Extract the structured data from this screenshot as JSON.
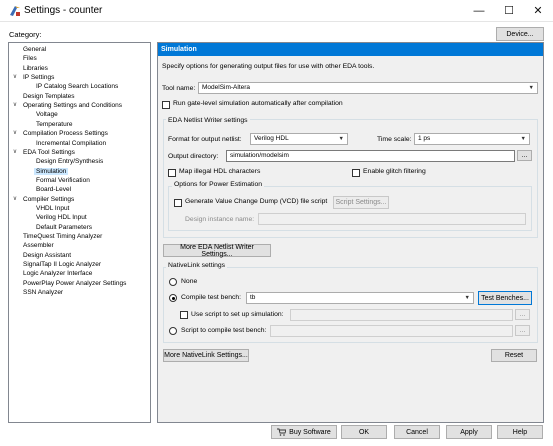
{
  "window": {
    "title": "Settings - counter",
    "minimize": "—",
    "maximize": "☐",
    "close": "✕"
  },
  "header": {
    "category_label": "Category:",
    "device_button": "Device..."
  },
  "tree": [
    {
      "label": "General",
      "level": 0
    },
    {
      "label": "Files",
      "level": 0
    },
    {
      "label": "Libraries",
      "level": 0
    },
    {
      "label": "IP Settings",
      "level": 0,
      "expanded": true
    },
    {
      "label": "IP Catalog Search Locations",
      "level": 1
    },
    {
      "label": "Design Templates",
      "level": 0
    },
    {
      "label": "Operating Settings and Conditions",
      "level": 0,
      "expanded": true
    },
    {
      "label": "Voltage",
      "level": 1
    },
    {
      "label": "Temperature",
      "level": 1
    },
    {
      "label": "Compilation Process Settings",
      "level": 0,
      "expanded": true
    },
    {
      "label": "Incremental Compilation",
      "level": 1
    },
    {
      "label": "EDA Tool Settings",
      "level": 0,
      "expanded": true
    },
    {
      "label": "Design Entry/Synthesis",
      "level": 1
    },
    {
      "label": "Simulation",
      "level": 1,
      "selected": true
    },
    {
      "label": "Formal Verification",
      "level": 1
    },
    {
      "label": "Board-Level",
      "level": 1
    },
    {
      "label": "Compiler Settings",
      "level": 0,
      "expanded": true
    },
    {
      "label": "VHDL Input",
      "level": 1
    },
    {
      "label": "Verilog HDL Input",
      "level": 1
    },
    {
      "label": "Default Parameters",
      "level": 1
    },
    {
      "label": "TimeQuest Timing Analyzer",
      "level": 0
    },
    {
      "label": "Assembler",
      "level": 0
    },
    {
      "label": "Design Assistant",
      "level": 0
    },
    {
      "label": "SignalTap II Logic Analyzer",
      "level": 0
    },
    {
      "label": "Logic Analyzer Interface",
      "level": 0
    },
    {
      "label": "PowerPlay Power Analyzer Settings",
      "level": 0
    },
    {
      "label": "SSN Analyzer",
      "level": 0
    }
  ],
  "panel": {
    "title": "Simulation",
    "description": "Specify options for generating output files for use with other EDA tools.",
    "tool_name_label": "Tool name:",
    "tool_name_value": "ModelSim-Altera",
    "gate_level_label": "Run gate-level simulation automatically after compilation",
    "netlist_group_title": "EDA Netlist Writer settings",
    "format_label": "Format for output netlist:",
    "format_value": "Verilog HDL",
    "timescale_label": "Time scale:",
    "timescale_value": "1 ps",
    "output_dir_label": "Output directory:",
    "output_dir_value": "simulation/modelsim",
    "map_illegal_label": "Map illegal HDL characters",
    "glitch_label": "Enable glitch filtering",
    "power_group_title": "Options for Power Estimation",
    "vcd_label": "Generate Value Change Dump (VCD) file script",
    "script_settings_button": "Script Settings...",
    "instance_name_label": "Design instance name:",
    "more_netlist_button": "More EDA Netlist Writer Settings...",
    "nativelink_group_title": "NativeLink settings",
    "none_label": "None",
    "compile_bench_label": "Compile test bench:",
    "compile_bench_value": "tb",
    "test_benches_button": "Test Benches...",
    "use_script_label": "Use script to set up simulation:",
    "script_compile_label": "Script to compile test bench:",
    "more_nativelink_button": "More NativeLink Settings...",
    "reset_button": "Reset",
    "ellipsis": "..."
  },
  "footer": {
    "buy_software": "Buy Software",
    "ok": "OK",
    "cancel": "Cancel",
    "apply": "Apply",
    "help": "Help"
  }
}
